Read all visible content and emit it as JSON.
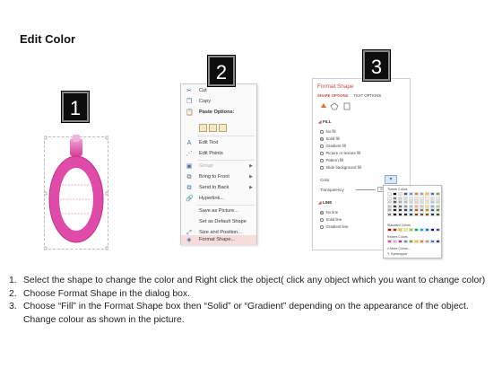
{
  "title": "Edit Color",
  "badges": [
    "1",
    "2",
    "3"
  ],
  "context_menu": {
    "items": [
      {
        "label": "Cut",
        "icon": "scissors-icon"
      },
      {
        "label": "Copy",
        "icon": "copy-icon"
      },
      {
        "label": "Paste Options:",
        "icon": "paste-icon"
      },
      {
        "label": "Edit Text",
        "icon": "edit-text-icon"
      },
      {
        "label": "Edit Points",
        "icon": "edit-points-icon"
      },
      {
        "label": "Group",
        "icon": "group-icon"
      },
      {
        "label": "Bring to Front",
        "icon": "bring-front-icon"
      },
      {
        "label": "Send to Back",
        "icon": "send-back-icon"
      },
      {
        "label": "Hyperlink...",
        "icon": "hyperlink-icon"
      },
      {
        "label": "Save as Picture...",
        "icon": ""
      },
      {
        "label": "Set as Default Shape",
        "icon": ""
      },
      {
        "label": "Size and Position...",
        "icon": "size-position-icon"
      },
      {
        "label": "Format Shape...",
        "icon": "format-shape-icon"
      }
    ]
  },
  "format_shape": {
    "title": "Format Shape",
    "tabs": [
      "SHAPE OPTIONS",
      "TEXT OPTIONS"
    ],
    "fill_section": "FILL",
    "fill_options": [
      "No fill",
      "Solid fill",
      "Gradient fill",
      "Picture or texture fill",
      "Pattern fill",
      "Slide background fill"
    ],
    "color_label": "Color",
    "transparency_label": "Transparency",
    "transparency_value": "0%",
    "line_section": "LINE",
    "line_options": [
      "No line",
      "Solid line",
      "Gradient line"
    ]
  },
  "palette": {
    "theme_label": "Theme Colors",
    "standard_label": "Standard Colors",
    "recent_label": "Recent Colors",
    "more_label": "More Colors...",
    "eyedropper_label": "Eyedropper"
  },
  "instructions": [
    {
      "num": "1.",
      "text": "Select the shape to change the color and Right click the object( click any object which you want to change color)"
    },
    {
      "num": "2.",
      "text": "Choose Format Shape in the dialog box."
    },
    {
      "num": "3.",
      "text": "Choose “Fill” in the Format Shape box then “Solid” or “Gradient” depending on the appearance of the object. Change colour as shown in the picture."
    }
  ],
  "colors": {
    "accent": "#c0504d",
    "shape_pink": "#e04aa8",
    "menu_highlight": "#f7dcdc"
  }
}
